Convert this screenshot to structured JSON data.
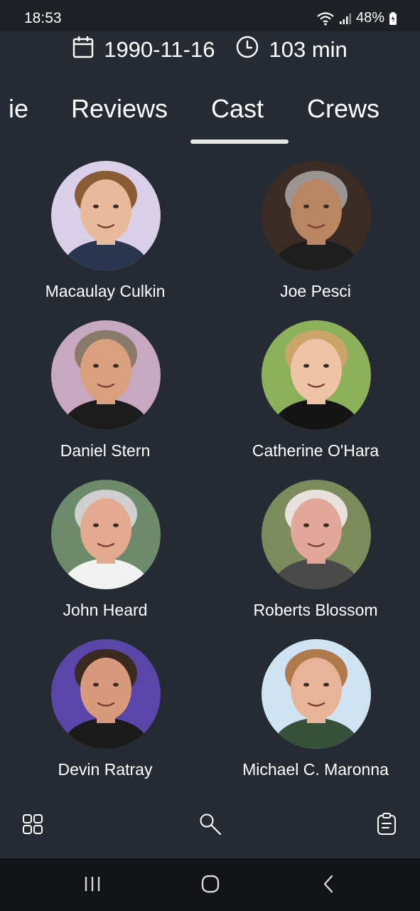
{
  "status_bar": {
    "time": "18:53",
    "battery": "48%",
    "icons": [
      "wifi-icon",
      "signal-icon",
      "battery-icon"
    ]
  },
  "movie_meta": {
    "release_date": "1990-11-16",
    "runtime": "103 min",
    "icons": [
      "calendar-icon",
      "clock-icon"
    ]
  },
  "tabs": {
    "partial_label": "ie",
    "items": [
      "Reviews",
      "Cast",
      "Crews"
    ],
    "active": "Cast"
  },
  "cast": [
    {
      "name": "Macaulay Culkin",
      "bg": "#d9cfe8",
      "skin": "#e8b99a",
      "hair": "#8a5b34",
      "shirt": "#2a3550"
    },
    {
      "name": "Joe Pesci",
      "bg": "#3b2b25",
      "skin": "#b98563",
      "hair": "#9a9590",
      "shirt": "#1e1e1e"
    },
    {
      "name": "Daniel Stern",
      "bg": "#c7a8c0",
      "skin": "#d8a07c",
      "hair": "#8a7a6a",
      "shirt": "#1c1c1c"
    },
    {
      "name": "Catherine O'Hara",
      "bg": "#8db15a",
      "skin": "#f0c2a6",
      "hair": "#caa46a",
      "shirt": "#141414"
    },
    {
      "name": "John Heard",
      "bg": "#6d8a6a",
      "skin": "#e4aa90",
      "hair": "#cfcfcf",
      "shirt": "#f1f1f1"
    },
    {
      "name": "Roberts Blossom",
      "bg": "#7c8a5c",
      "skin": "#e2a79a",
      "hair": "#e7e0dc",
      "shirt": "#4a4a4a"
    },
    {
      "name": "Devin Ratray",
      "bg": "#5a45a8",
      "skin": "#d89a7c",
      "hair": "#3b2a20",
      "shirt": "#1a1a1a"
    },
    {
      "name": "Michael C. Maronna",
      "bg": "#cfe3f2",
      "skin": "#e9b398",
      "hair": "#b07a4a",
      "shirt": "#36503a"
    }
  ],
  "bottom_nav": {
    "icons": [
      "grid-icon",
      "search-icon",
      "clipboard-icon"
    ]
  },
  "system_nav": {
    "icons": [
      "recent-apps-icon",
      "home-icon",
      "back-icon"
    ]
  },
  "colors": {
    "background": "#262b33",
    "status_bar": "#1d2025",
    "system_nav": "#121316",
    "text": "#ffffff",
    "tab_indicator": "#e6e6e6"
  }
}
